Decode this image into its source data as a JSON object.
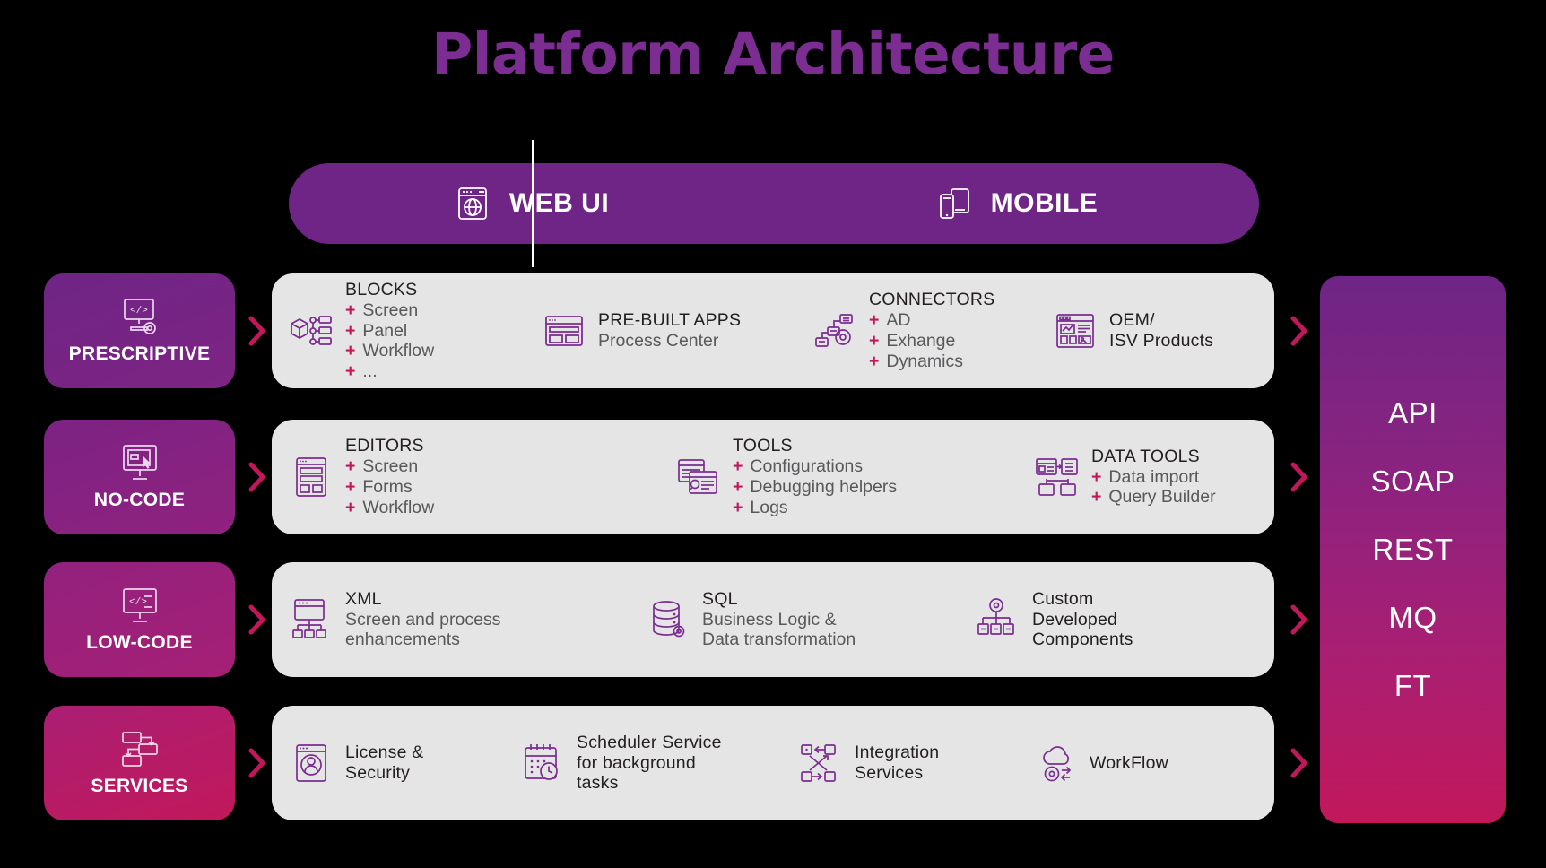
{
  "title": "Platform Architecture",
  "colors": {
    "title_purple": "#7B2D91",
    "bar_purple": "#6E2585",
    "accent_magenta": "#C2185B",
    "panel_grey": "#E5E5E5",
    "background": "#000000"
  },
  "channels": [
    {
      "label": "WEB UI",
      "icon": "browser-globe-icon"
    },
    {
      "label": "MOBILE",
      "icon": "phone-tablet-icon"
    }
  ],
  "tiers": [
    {
      "label": "PRESCRIPTIVE",
      "icon": "monitor-code-gear-icon",
      "gradient": [
        "#6E2585",
        "#7E2484"
      ],
      "cells": [
        {
          "icon": "blocks-cube-icon",
          "head": "BLOCKS",
          "bullets": [
            "Screen",
            "Panel",
            "Workflow",
            "..."
          ]
        },
        {
          "icon": "prebuilt-apps-window-icon",
          "head": "PRE-BUILT APPS",
          "sub": "Process Center"
        },
        {
          "icon": "connectors-gear-icon",
          "head": "CONNECTORS",
          "bullets": [
            "AD",
            "Exhange",
            "Dynamics"
          ]
        },
        {
          "icon": "oem-dashboard-icon",
          "head": "OEM/",
          "sub": "ISV Products"
        }
      ]
    },
    {
      "label": "NO-CODE",
      "icon": "monitor-cursor-icon",
      "gradient": [
        "#7C2384",
        "#8E2280"
      ],
      "cells": [
        {
          "icon": "editor-form-icon",
          "head": "EDITORS",
          "bullets": [
            "Screen",
            "Forms",
            "Workflow"
          ]
        },
        {
          "icon": "tools-search-window-icon",
          "head": "TOOLS",
          "bullets": [
            "Configurations",
            "Debugging helpers",
            "Logs"
          ]
        },
        {
          "icon": "data-tools-server-icon",
          "head": "DATA TOOLS",
          "bullets": [
            "Data import",
            "Query Builder"
          ]
        }
      ]
    },
    {
      "label": "LOW-CODE",
      "icon": "monitor-code-icon",
      "gradient": [
        "#92217E",
        "#A42076"
      ],
      "cells": [
        {
          "icon": "xml-window-tree-icon",
          "head": "XML",
          "sub": "Screen and process\nenhancements"
        },
        {
          "icon": "sql-database-icon",
          "head": "SQL",
          "sub": "Business Logic &\nData transformation"
        },
        {
          "icon": "custom-components-gear-icon",
          "head": "Custom\nDeveloped\nComponents"
        }
      ]
    },
    {
      "label": "SERVICES",
      "icon": "services-flow-icon",
      "gradient": [
        "#AA1F73",
        "#C2185B"
      ],
      "cells": [
        {
          "icon": "license-user-icon",
          "head": "License &\nSecurity"
        },
        {
          "icon": "calendar-clock-icon",
          "head": "Scheduler Service\nfor background\ntasks"
        },
        {
          "icon": "integration-arrows-icon",
          "head": "Integration\nServices"
        },
        {
          "icon": "workflow-cloud-gear-icon",
          "head": "WorkFlow"
        }
      ]
    }
  ],
  "protocols": [
    "API",
    "SOAP",
    "REST",
    "MQ",
    "FT"
  ],
  "arrow_icon": "chevron-right-icon"
}
